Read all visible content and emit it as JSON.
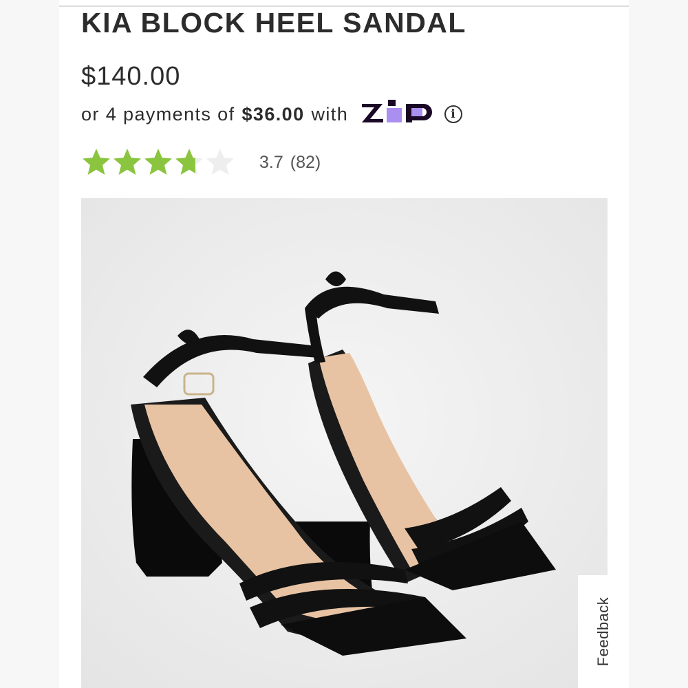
{
  "product": {
    "title": "KIA BLOCK HEEL SANDAL",
    "price": "$140.00"
  },
  "installments": {
    "prefix": "or 4 payments of",
    "amount": "$36.00",
    "suffix": "with",
    "provider_logo": "zip",
    "info_icon": "info-circle-icon"
  },
  "rating": {
    "value": 3.7,
    "value_label": "3.7",
    "count_label": "(82)",
    "max": 5,
    "star_color": "#8bc53f",
    "empty_star_color": "#eeeeee"
  },
  "feedback": {
    "label": "Feedback"
  },
  "colors": {
    "text": "#2c2c2c",
    "zip_dark": "#1a0826",
    "zip_purple": "#aa8ff0"
  }
}
